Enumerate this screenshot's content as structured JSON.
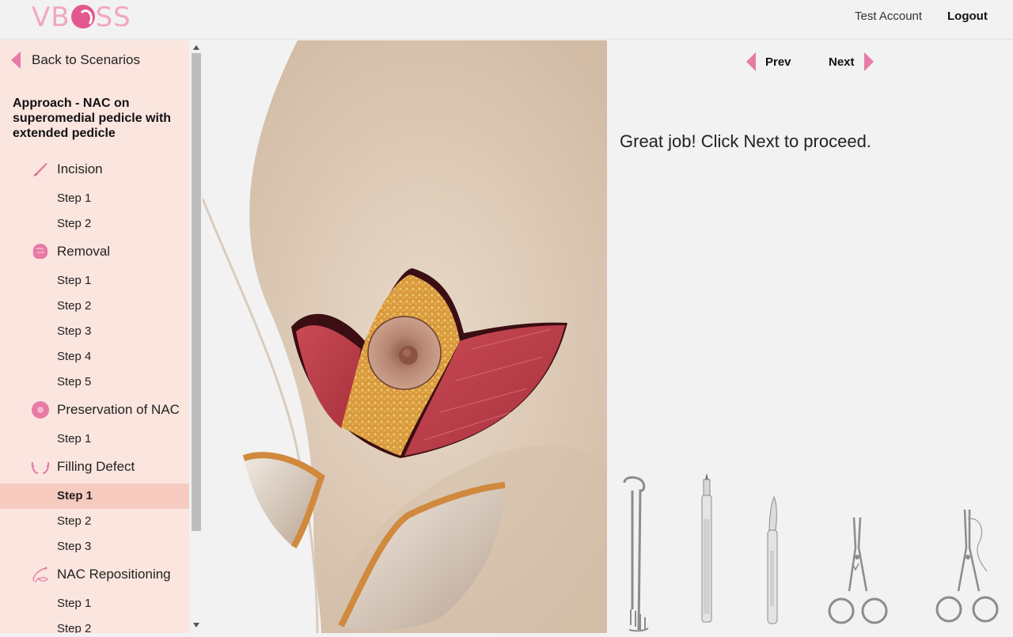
{
  "header": {
    "logo_text": "VBOSS",
    "account_label": "Test Account",
    "logout_label": "Logout"
  },
  "sidebar": {
    "back_label": "Back to Scenarios",
    "scenario_title": "Approach - NAC on superomedial pedicle with extended pedicle",
    "sections": [
      {
        "label": "Incision",
        "icon": "scalpel-icon",
        "steps": [
          "Step 1",
          "Step 2"
        ]
      },
      {
        "label": "Removal",
        "icon": "tissue-blob-icon",
        "steps": [
          "Step 1",
          "Step 2",
          "Step 3",
          "Step 4",
          "Step 5"
        ]
      },
      {
        "label": "Preservation of NAC",
        "icon": "nipple-circle-icon",
        "steps": [
          "Step 1"
        ]
      },
      {
        "label": "Filling Defect",
        "icon": "breast-outline-icon",
        "steps": [
          "Step 1",
          "Step 2",
          "Step 3"
        ]
      },
      {
        "label": "NAC Repositioning",
        "icon": "suture-needle-icon",
        "steps": [
          "Step 1",
          "Step 2"
        ]
      }
    ],
    "active_step": "Filling Defect / Step 1"
  },
  "nav": {
    "prev_label": "Prev",
    "next_label": "Next"
  },
  "message": "Great job! Click Next to proceed.",
  "tools": [
    {
      "name": "retractor-tool"
    },
    {
      "name": "marker-pen-tool"
    },
    {
      "name": "scalpel-tool"
    },
    {
      "name": "hemostat-tool"
    },
    {
      "name": "needle-holder-tool"
    }
  ],
  "colors": {
    "accent": "#e77ba6",
    "sidebar_bg": "#fbe5df",
    "active_step_bg": "#f7cbbf",
    "logo": "#f1a7c3"
  }
}
